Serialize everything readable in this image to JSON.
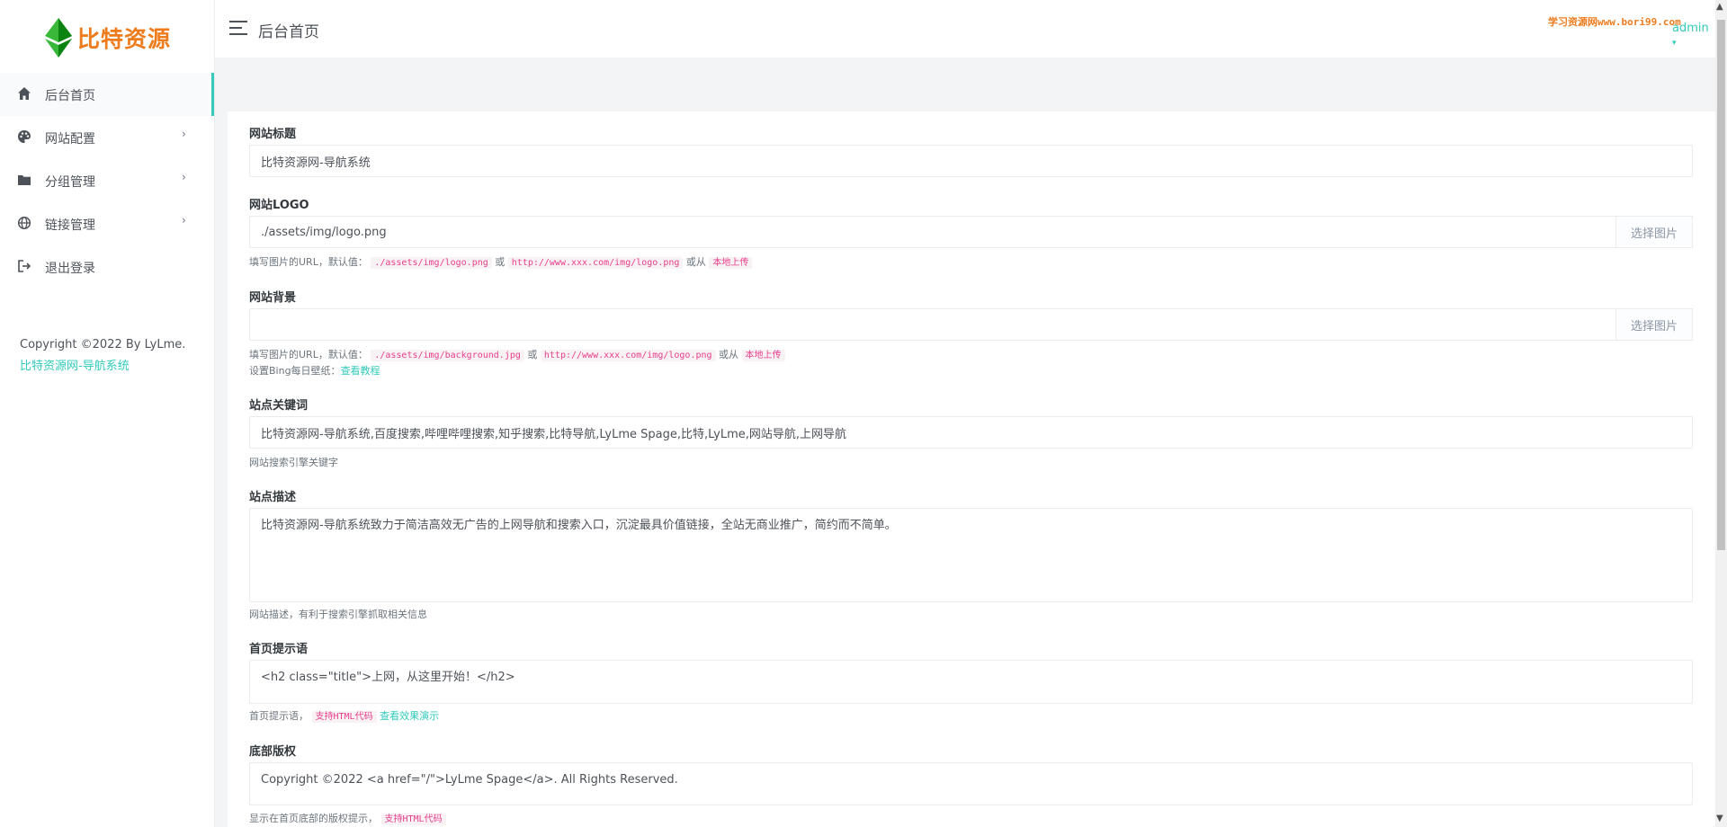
{
  "brand": {
    "name": "比特资源"
  },
  "sidebar": {
    "items": [
      {
        "label": "后台首页",
        "icon": "home-icon"
      },
      {
        "label": "网站配置",
        "icon": "palette-icon",
        "arrow": "›"
      },
      {
        "label": "分组管理",
        "icon": "folder-icon",
        "arrow": "›"
      },
      {
        "label": "链接管理",
        "icon": "globe-icon",
        "arrow": "›"
      },
      {
        "label": "退出登录",
        "icon": "logout-icon"
      }
    ],
    "copyright_text": "Copyright ©2022 By LyLme.",
    "copyright_link": "比特资源网-导航系统"
  },
  "header": {
    "title": "后台首页",
    "watermark": "学习资源网www.bori99.com",
    "user": "admin"
  },
  "form": {
    "site_title": {
      "label": "网站标题",
      "value": "比特资源网-导航系统"
    },
    "site_logo": {
      "label": "网站LOGO",
      "value": "./assets/img/logo.png",
      "button": "选择图片",
      "help_prefix": "填写图片的URL，默认值：",
      "default_path": "./assets/img/logo.png",
      "or1": "或",
      "example_url": "http://www.xxx.com/img/logo.png",
      "or2": "或从",
      "local_upload": "本地上传"
    },
    "site_background": {
      "label": "网站背景",
      "value": "",
      "button": "选择图片",
      "help_prefix": "填写图片的URL，默认值：",
      "default_path": "./assets/img/background.jpg",
      "or1": "或",
      "example_url": "http://www.xxx.com/img/logo.png",
      "or2": "或从",
      "local_upload": "本地上传",
      "bing_prefix": "设置Bing每日壁纸：",
      "bing_link": "查看教程"
    },
    "keywords": {
      "label": "站点关键词",
      "value": "比特资源网-导航系统,百度搜索,哔哩哔哩搜索,知乎搜索,比特导航,LyLme Spage,比特,LyLme,网站导航,上网导航",
      "help": "网站搜索引擎关键字"
    },
    "description": {
      "label": "站点描述",
      "value": "比特资源网-导航系统致力于简洁高效无广告的上网导航和搜索入口，沉淀最具价值链接，全站无商业推广，简约而不简单。",
      "help": "网站描述，有利于搜索引擎抓取相关信息"
    },
    "home_tip": {
      "label": "首页提示语",
      "value": "<h2 class=\"title\">上网，从这里开始！</h2>",
      "help_prefix": "首页提示语，",
      "html_badge": "支持HTML代码",
      "demo_link": "查看效果演示"
    },
    "footer": {
      "label": "底部版权",
      "value": "Copyright ©2022 <a href=\"/\">LyLme Spage</a>.  All Rights Reserved.",
      "help_prefix": "显示在首页底部的版权提示，",
      "html_badge": "支持HTML代码"
    }
  },
  "colors": {
    "accent": "#33cabb",
    "brand": "#ee7b1c",
    "code": "#e83e8c"
  }
}
